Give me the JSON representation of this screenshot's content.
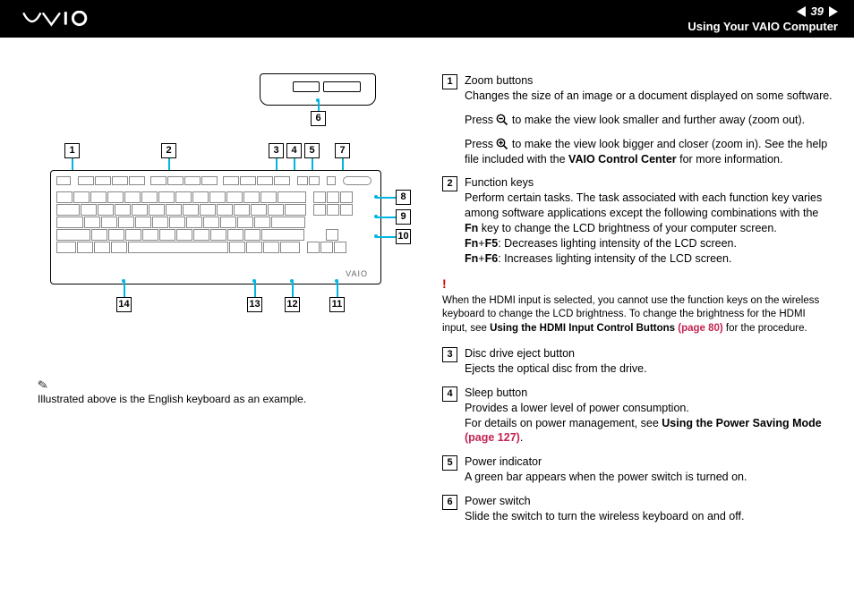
{
  "header": {
    "page_number": "39",
    "section": "Using Your VAIO Computer"
  },
  "diagram": {
    "callouts": [
      "1",
      "2",
      "3",
      "4",
      "5",
      "6",
      "7",
      "8",
      "9",
      "10",
      "11",
      "12",
      "13",
      "14"
    ],
    "badge": "VAIO"
  },
  "note": {
    "pencil": "✎",
    "text": "Illustrated above is the English keyboard as an example."
  },
  "items": {
    "1": {
      "title": "Zoom buttons",
      "desc": "Changes the size of an image or a document displayed on some software.",
      "p2a": "Press ",
      "p2b": " to make the view look smaller and further away (zoom out).",
      "p3a": "Press ",
      "p3b": " to make the view look bigger and closer (zoom in). See the help file included with the ",
      "p3c": "VAIO Control Center",
      "p3d": " for more information."
    },
    "2": {
      "title": "Function keys",
      "desc": "Perform certain tasks. The task associated with each function key varies among software applications except the following combinations with the ",
      "fn": "Fn",
      "desc2": " key to change the LCD brightness of your computer screen.",
      "l1a": "Fn",
      "l1b": "+",
      "l1c": "F5",
      "l1d": ": Decreases lighting intensity of the LCD screen.",
      "l2a": "Fn",
      "l2b": "+",
      "l2c": "F6",
      "l2d": ": Increases lighting intensity of the LCD screen."
    },
    "warn": {
      "bang": "!",
      "text1": "When the HDMI input is selected, you cannot use the function keys on the wireless keyboard to change the LCD brightness. To change the brightness for the HDMI input, see ",
      "link": "Using the HDMI Input Control Buttons",
      "page": " (page 80)",
      "text2": " for the procedure."
    },
    "3": {
      "title": "Disc drive eject button",
      "desc": "Ejects the optical disc from the drive."
    },
    "4": {
      "title": "Sleep button",
      "desc": "Provides a lower level of power consumption.",
      "more": "For details on power management, see ",
      "link": "Using the Power Saving Mode",
      "page": " (page 127)",
      "end": "."
    },
    "5": {
      "title": "Power indicator",
      "desc": "A green bar appears when the power switch is turned on."
    },
    "6": {
      "title": "Power switch",
      "desc": "Slide the switch to turn the wireless keyboard on and off."
    }
  }
}
